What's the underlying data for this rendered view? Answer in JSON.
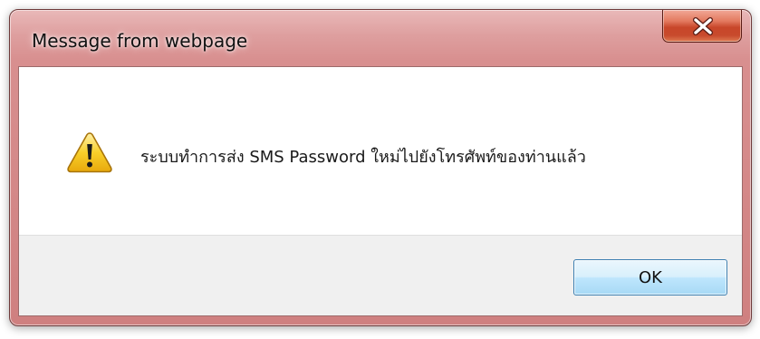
{
  "dialog": {
    "title": "Message from webpage",
    "close_icon": "close-x-icon",
    "message_icon": "warning-triangle-icon",
    "message": "ระบบทำการส่ง SMS Password ใหม่ไปยังโทรศัพท์ของท่านแล้ว",
    "ok_label": "OK"
  },
  "colors": {
    "frame": "#d88f8f",
    "close_button": "#c8462a",
    "ok_button": "#bee6fd",
    "footer": "#f0f0f0",
    "warning": "#f6c21c"
  }
}
